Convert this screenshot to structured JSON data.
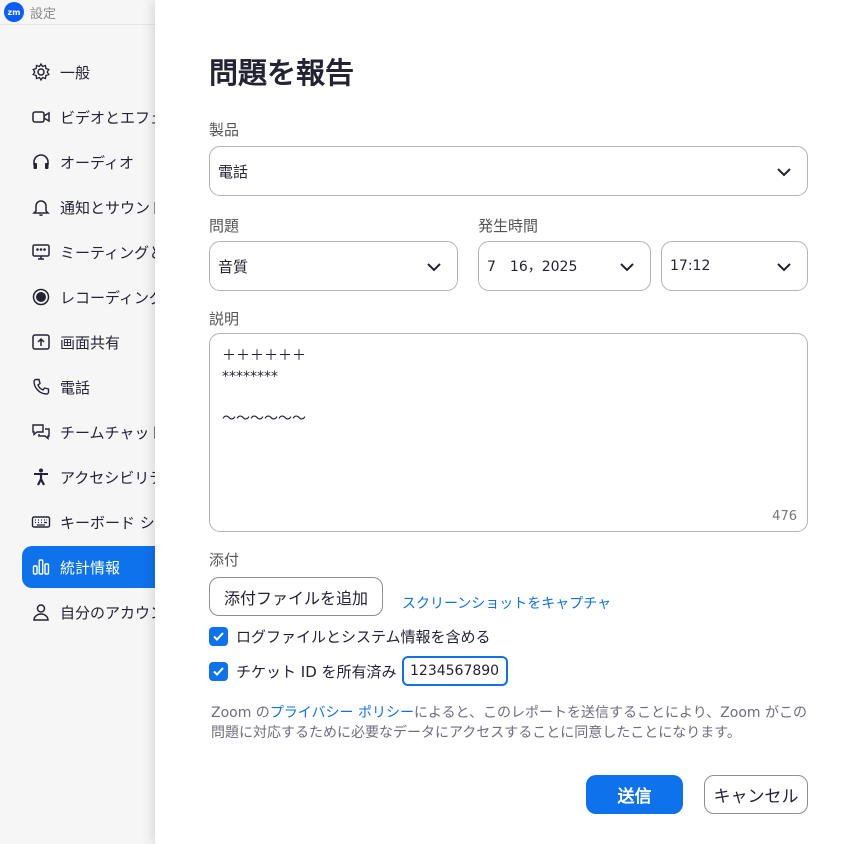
{
  "window": {
    "app_logo": "zm",
    "title": "設定"
  },
  "sidebar": {
    "items": [
      {
        "label": "一般",
        "icon": "gear-icon"
      },
      {
        "label": "ビデオとエフェクト",
        "icon": "video-camera-icon"
      },
      {
        "label": "オーディオ",
        "icon": "headphones-icon"
      },
      {
        "label": "通知とサウンド",
        "icon": "bell-icon"
      },
      {
        "label": "ミーティングとウェビナー",
        "icon": "meeting-screen-icon"
      },
      {
        "label": "レコーディング",
        "icon": "record-icon"
      },
      {
        "label": "画面共有",
        "icon": "share-screen-icon"
      },
      {
        "label": "電話",
        "icon": "phone-icon"
      },
      {
        "label": "チームチャット",
        "icon": "chat-bubbles-icon"
      },
      {
        "label": "アクセシビリティ",
        "icon": "accessibility-icon"
      },
      {
        "label": "キーボード ショートカット",
        "icon": "keyboard-icon"
      },
      {
        "label": "統計情報",
        "icon": "bar-chart-icon",
        "active": true
      },
      {
        "label": "自分のアカウント",
        "icon": "person-icon"
      }
    ]
  },
  "dialog": {
    "title": "問題を報告",
    "product_label": "製品",
    "product_value": "電話",
    "issue_label": "問題",
    "issue_value": "音質",
    "time_label": "発生時間",
    "date_value": "7　16，2025",
    "time_value": "17:12",
    "description_label": "説明",
    "description_lines": [
      "＋＋＋＋＋＋",
      "********",
      "",
      "～～～～～～"
    ],
    "char_counter": "476",
    "attachment_label": "添付",
    "attach_button": "添付ファイルを追加",
    "capture_link": "スクリーンショットをキャプチャ",
    "include_logs_label": "ログファイルとシステム情報を含める",
    "include_logs_checked": true,
    "ticket_label": "チケット ID を所有済み",
    "ticket_checked": true,
    "ticket_value": "1234567890",
    "privacy_prefix": "Zoom の",
    "privacy_link": "プライバシー ポリシー",
    "privacy_suffix": "によると、このレポートを送信することにより、Zoom がこの問題に対応するために必要なデータにアクセスすることに同意したことになります。",
    "send_button": "送信",
    "cancel_button": "キャンセル"
  },
  "colors": {
    "accent": "#0e72ed",
    "brand": "#0b5cff"
  }
}
